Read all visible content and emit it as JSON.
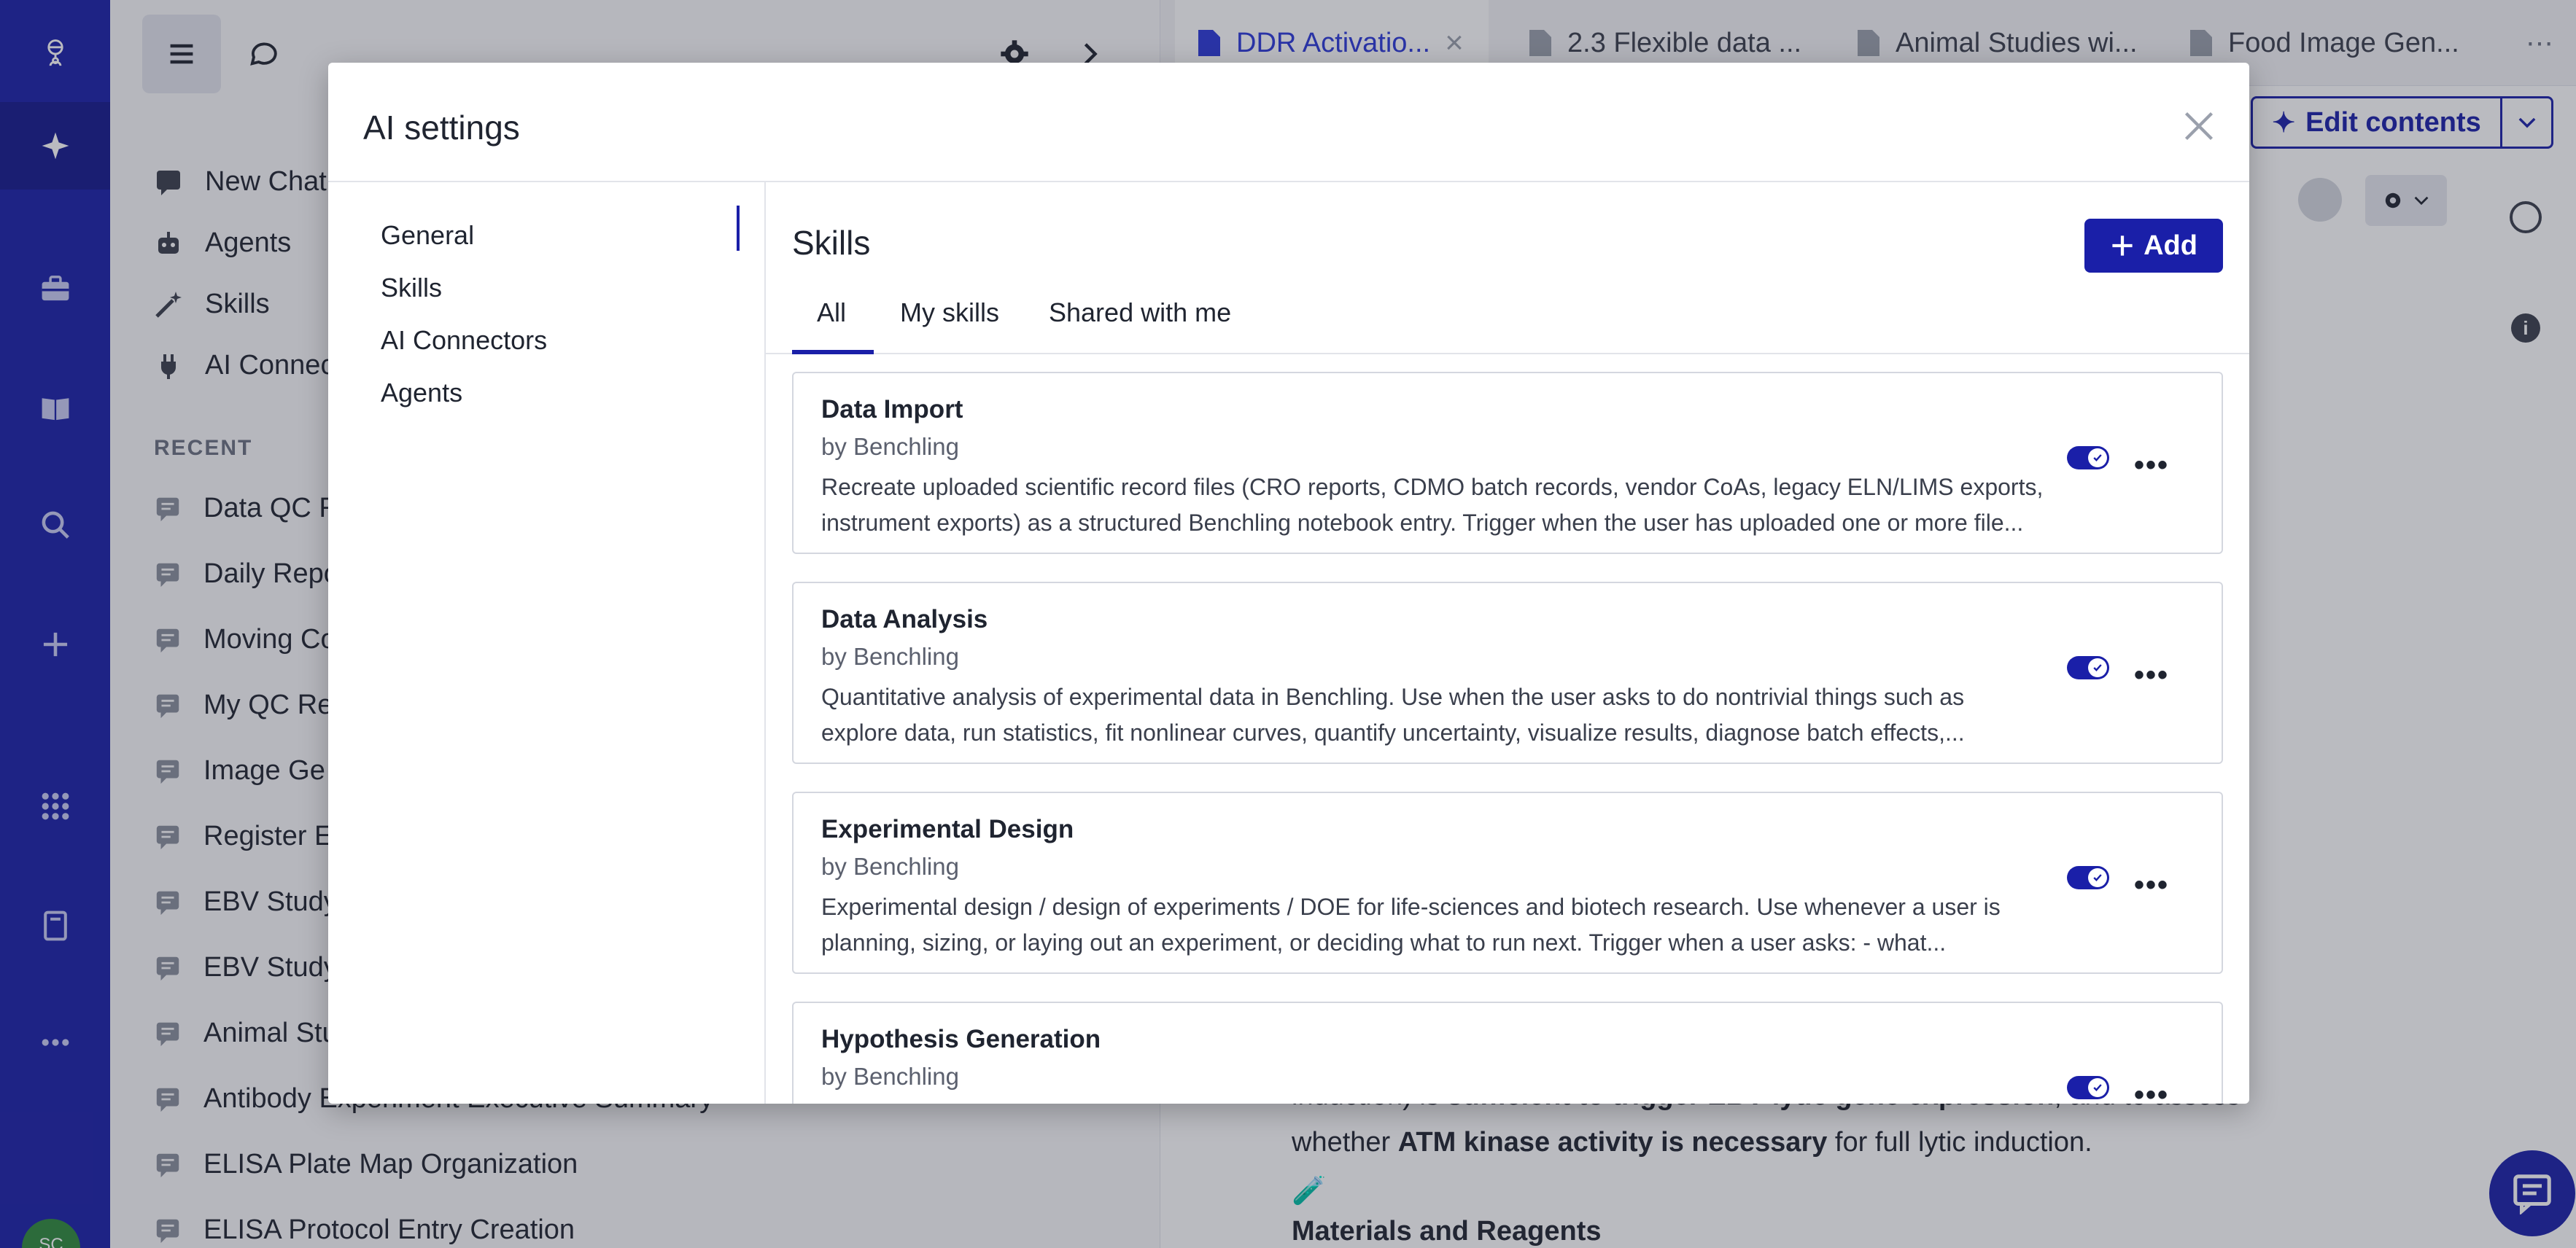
{
  "rail": {
    "icons": [
      "logo-icon",
      "sparkle-icon",
      "briefcase-icon",
      "book-icon",
      "search-icon",
      "plus-icon",
      "apps-grid-icon",
      "notebook-icon",
      "more-icon"
    ],
    "avatar_initials": "SC"
  },
  "sidebar": {
    "nav": [
      {
        "label": "New Chat",
        "icon": "chat-icon"
      },
      {
        "label": "Agents",
        "icon": "robot-icon"
      },
      {
        "label": "Skills",
        "icon": "magic-wand-icon"
      },
      {
        "label": "AI Connectors",
        "icon": "plug-icon"
      }
    ],
    "recent_label": "RECENT",
    "recent": [
      "Data QC R",
      "Daily Repo",
      "Moving Co",
      "My QC Re",
      "Image Ge",
      "Register E",
      "EBV Study",
      "EBV Study",
      "Animal Stu",
      "Antibody Experiment Executive Summary",
      "ELISA Plate Map Organization",
      "ELISA Protocol Entry Creation"
    ]
  },
  "doc": {
    "tabs": [
      {
        "label": "DDR Activatio...",
        "active": true
      },
      {
        "label": "2.3 Flexible data ..."
      },
      {
        "label": "Animal Studies wi..."
      },
      {
        "label": "Food Image Gen..."
      }
    ],
    "edit_label": "Edit contents",
    "text_line1_a": "induction) is ",
    "text_line1_b": "sufficient to trigger EBV lytic gene expression",
    "text_line1_c": ", and to assess",
    "text_line2_a": "whether ",
    "text_line2_b": "ATM kinase activity is necessary",
    "text_line2_c": " for full lytic induction.",
    "heading": "Materials and Reagents"
  },
  "modal": {
    "title": "AI settings",
    "nav": [
      "General",
      "Skills",
      "AI Connectors",
      "Agents"
    ],
    "section_title": "Skills",
    "add_label": "Add",
    "tabs": [
      "All",
      "My skills",
      "Shared with me"
    ],
    "skills": [
      {
        "name": "Data Import",
        "by": "by Benchling",
        "desc1": "Recreate uploaded scientific record files (CRO reports, CDMO batch records, vendor CoAs, legacy ELN/LIMS exports,",
        "desc2": "instrument exports) as a structured Benchling notebook entry. Trigger when the user has uploaded one or more file...",
        "enabled": true
      },
      {
        "name": "Data Analysis",
        "by": "by Benchling",
        "desc1": "Quantitative analysis of experimental data in Benchling. Use when the user asks to do nontrivial things such as",
        "desc2": "explore data, run statistics, fit nonlinear curves, quantify uncertainty, visualize results, diagnose batch effects,...",
        "enabled": true
      },
      {
        "name": "Experimental Design",
        "by": "by Benchling",
        "desc1": "Experimental design / design of experiments / DOE for life-sciences and biotech research. Use whenever a user is",
        "desc2": "planning, sizing, or laying out an experiment, or deciding what to run next. Trigger when a user asks: - what...",
        "enabled": true
      },
      {
        "name": "Hypothesis Generation",
        "by": "by Benchling",
        "desc1": "",
        "desc2": "",
        "enabled": true
      }
    ]
  },
  "colors": {
    "primary": "#1a1fa8",
    "rail": "#1a1fa8",
    "active_tab": "#2b38d9"
  }
}
